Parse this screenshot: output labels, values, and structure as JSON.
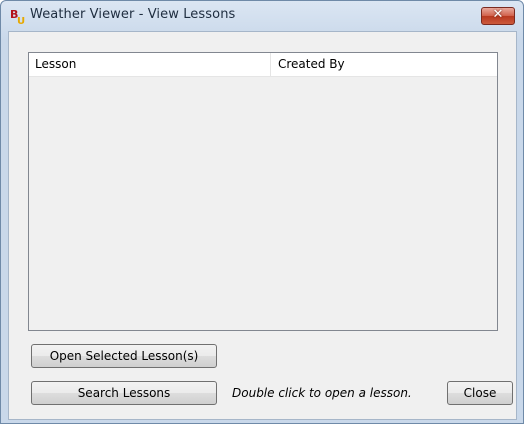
{
  "window": {
    "title": "Weather Viewer - View Lessons",
    "app_icon": "bu-logo-icon",
    "close_glyph": "✕"
  },
  "list": {
    "columns": [
      "Lesson",
      "Created By"
    ],
    "rows": []
  },
  "buttons": {
    "open_selected": "Open Selected Lesson(s)",
    "search": "Search Lessons",
    "close": "Close"
  },
  "hint": "Double click to open a lesson.",
  "colors": {
    "close_button": "#c9472b",
    "icon_b": "#b3121b",
    "icon_u": "#e6a800"
  }
}
